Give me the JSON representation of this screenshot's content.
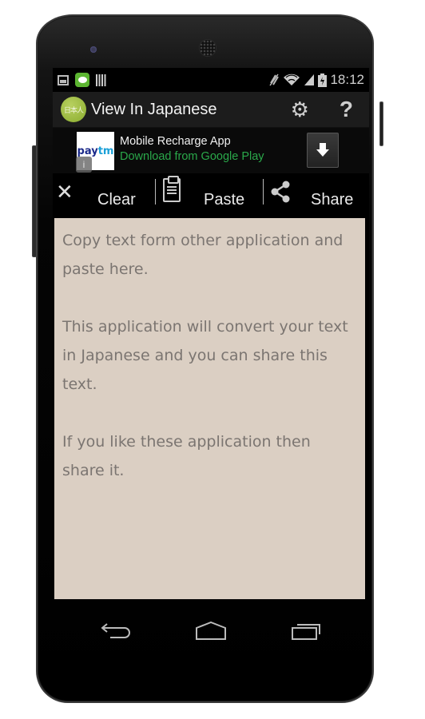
{
  "status_bar": {
    "notifications": [
      "gallery-icon",
      "line-app-icon",
      "barcode-icon"
    ],
    "system_icons": [
      "mute-icon",
      "wifi-icon",
      "signal-icon",
      "battery-charging-icon"
    ],
    "time": "18:12"
  },
  "action_bar": {
    "logo_text": "日本人",
    "title": "View In Japanese",
    "actions": [
      {
        "name": "settings",
        "icon": "⚙"
      },
      {
        "name": "help",
        "icon": "?"
      }
    ]
  },
  "ad": {
    "logo_text_1": "pay",
    "logo_text_2": "tm",
    "title": "Mobile Recharge App",
    "subtitle": "Download from Google Play",
    "download_icon": "⬇",
    "info_icon": "i",
    "subtitle_color": "#2aa84a"
  },
  "toolbar": {
    "clear_icon": "✕",
    "clear_label": "Clear",
    "paste_label": "Paste",
    "share_label": "Share"
  },
  "editor": {
    "text": "Copy text form other application and paste here.\n\nThis application will convert your text in Japanese and you can share this text.\n\nIf you like these application then share it.",
    "background": "#dbcfc3"
  },
  "nav": {
    "back": "back-icon",
    "home": "home-icon",
    "recents": "recents-icon"
  }
}
